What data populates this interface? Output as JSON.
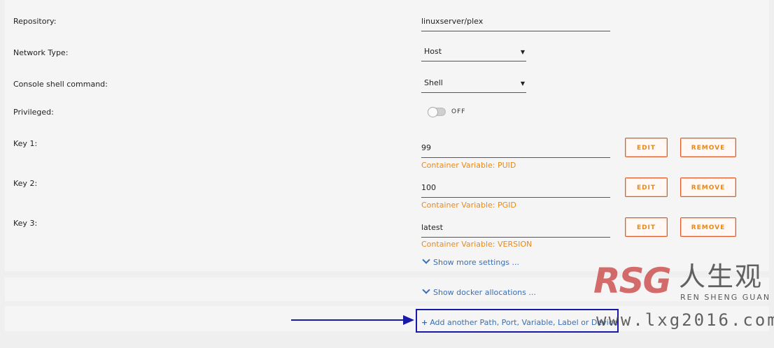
{
  "fields": {
    "repository_label": "Repository:",
    "repository_value": "linuxserver/plex",
    "network_label": "Network Type:",
    "network_value": "Host",
    "console_label": "Console shell command:",
    "console_value": "Shell",
    "privileged_label": "Privileged:",
    "privileged_state": "OFF"
  },
  "keys": [
    {
      "label": "Key 1:",
      "value": "99",
      "hint": "Container Variable: PUID",
      "edit": "EDIT",
      "remove": "REMOVE"
    },
    {
      "label": "Key 2:",
      "value": "100",
      "hint": "Container Variable: PGID",
      "edit": "EDIT",
      "remove": "REMOVE"
    },
    {
      "label": "Key 3:",
      "value": "latest",
      "hint": "Container Variable: VERSION",
      "edit": "EDIT",
      "remove": "REMOVE"
    }
  ],
  "links": {
    "more_settings": "Show more settings ...",
    "docker_allocations": "Show docker allocations ...",
    "add_another": "Add another Path, Port, Variable, Label or Device"
  },
  "watermark": {
    "logo": "RSG",
    "cn": "人生观",
    "sub": "REN SHENG GUAN",
    "url": "www.lxg2016.com"
  },
  "colors": {
    "accent_orange": "#e68a1e",
    "button_border": "#e05a2a",
    "link_blue": "#3a6fb5",
    "annotation_blue": "#1a1aa8"
  },
  "icons": {
    "caret": "caret-down-icon",
    "chevron": "chevron-down-icon",
    "plus": "plus-icon",
    "arrow": "arrow-right-icon"
  }
}
